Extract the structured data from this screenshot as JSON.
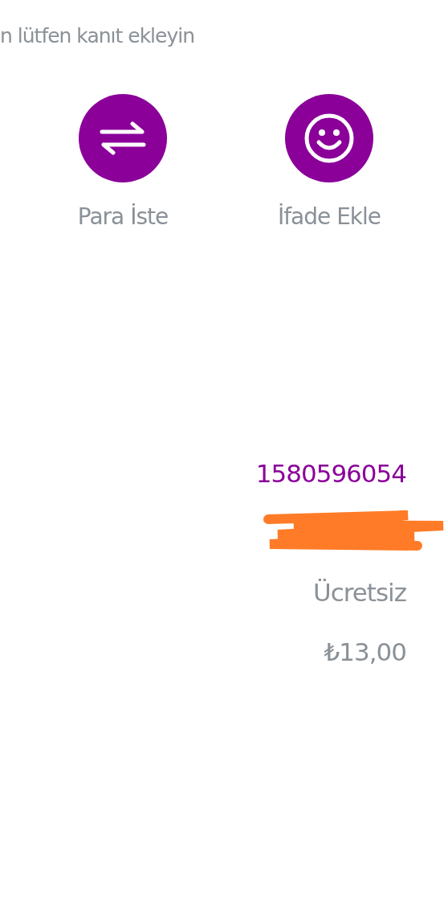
{
  "hint": "n lütfen kanıt ekleyin",
  "actions": [
    {
      "kind": "request",
      "label": "Para İste"
    },
    {
      "kind": "emoji",
      "label": "İfade Ekle"
    }
  ],
  "details": [
    {
      "kind": "number",
      "text": "1580596054"
    },
    {
      "kind": "redacted"
    },
    {
      "kind": "plain",
      "text": "Ücretsiz"
    },
    {
      "kind": "plain",
      "text": "₺13,00"
    }
  ]
}
